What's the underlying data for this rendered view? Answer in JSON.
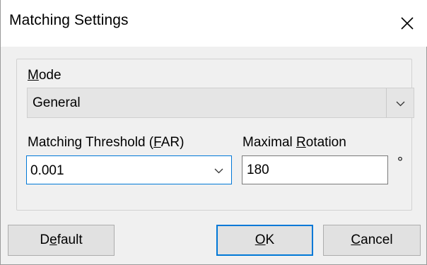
{
  "window": {
    "title": "Matching Settings",
    "close_icon": "close-icon"
  },
  "mode": {
    "label_prefix": "",
    "label_mnemonic": "M",
    "label_rest": "ode",
    "value": "General",
    "arrow_icon": "chevron-down-icon"
  },
  "threshold": {
    "label_before": "Matching Threshold (",
    "label_mnemonic": "F",
    "label_after": "AR)",
    "value": "0.001",
    "arrow_icon": "chevron-down-icon"
  },
  "rotation": {
    "label_before": "Maximal ",
    "label_mnemonic": "R",
    "label_after": "otation",
    "value": "180",
    "unit": "°"
  },
  "buttons": {
    "default_before": "D",
    "default_mnemonic": "e",
    "default_after": "fault",
    "ok_before": "",
    "ok_mnemonic": "O",
    "ok_after": "K",
    "cancel_before": "",
    "cancel_mnemonic": "C",
    "cancel_after": "ancel"
  },
  "colors": {
    "accent": "#0078d7",
    "background": "#f0f0f0",
    "titlebar": "#ffffff",
    "button": "#e1e1e1"
  }
}
